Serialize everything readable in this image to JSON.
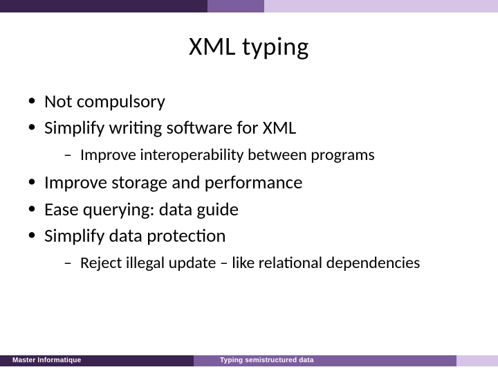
{
  "title": "XML typing",
  "bullets": [
    {
      "text": "Not compulsory"
    },
    {
      "text": "Simplify writing software for XML",
      "sub": [
        "Improve interoperability between programs"
      ]
    },
    {
      "text": "Improve storage and performance"
    },
    {
      "text": "Ease querying: data guide"
    },
    {
      "text": "Simplify data protection",
      "sub": [
        "Reject illegal update – like relational dependencies"
      ]
    }
  ],
  "footer": {
    "left": "Master Informatique",
    "center": "Typing semistructured data"
  },
  "colors": {
    "banner_dark": "#3b234f",
    "banner_mid": "#7c5d9e",
    "banner_light": "#d5c4e6"
  }
}
